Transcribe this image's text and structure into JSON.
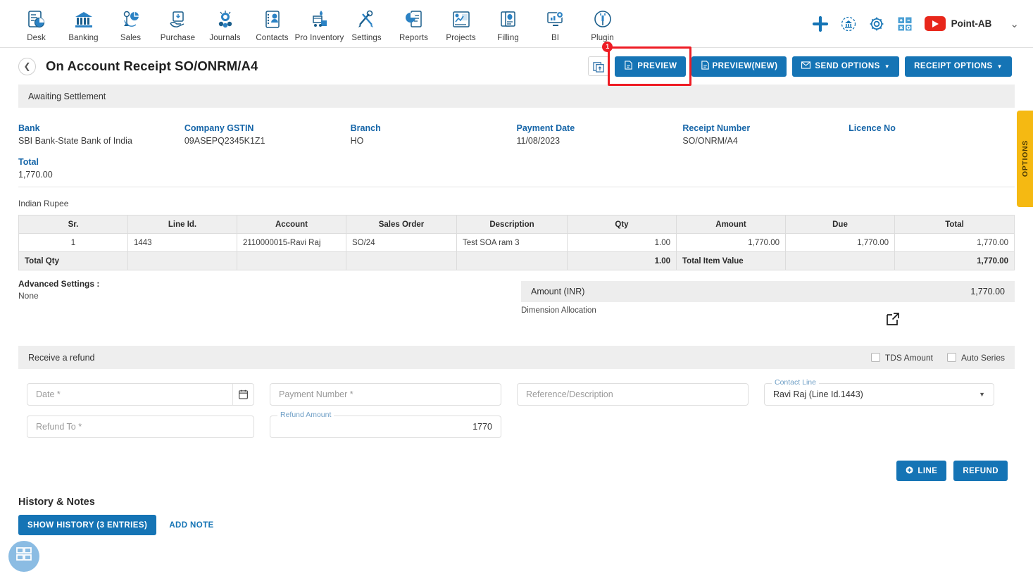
{
  "topnav": {
    "items": [
      {
        "label": "Desk",
        "icon": "desk-icon"
      },
      {
        "label": "Banking",
        "icon": "bank-icon"
      },
      {
        "label": "Sales",
        "icon": "sales-icon"
      },
      {
        "label": "Purchase",
        "icon": "purchase-icon"
      },
      {
        "label": "Journals",
        "icon": "journals-icon"
      },
      {
        "label": "Contacts",
        "icon": "contacts-icon"
      },
      {
        "label": "Pro Inventory",
        "icon": "inventory-icon"
      },
      {
        "label": "Settings",
        "icon": "settings-tools-icon"
      },
      {
        "label": "Reports",
        "icon": "reports-icon"
      },
      {
        "label": "Projects",
        "icon": "projects-icon"
      },
      {
        "label": "Filling",
        "icon": "filling-icon"
      },
      {
        "label": "BI",
        "icon": "bi-icon"
      },
      {
        "label": "Plugin",
        "icon": "plugin-icon"
      }
    ],
    "right": {
      "add_icon": "plus-icon",
      "refresh_bank_icon": "bank-sync-icon",
      "settings_icon": "gear-icon",
      "calculator_icon": "calculator-icon",
      "video_icon": "youtube-icon",
      "brand": "Point-AB",
      "caret_icon": "chevron-down-icon"
    },
    "accent": "#1574b5"
  },
  "header": {
    "back_icon": "chevron-left-icon",
    "title": "On Account Receipt SO/ONRM/A4",
    "upload_icon": "upload-doc-icon",
    "buttons": [
      {
        "label": "PREVIEW",
        "icon": "pdf-icon",
        "highlighted": true,
        "badge": "1"
      },
      {
        "label": "PREVIEW(NEW)",
        "icon": "pdf-icon",
        "highlighted": false
      },
      {
        "label": "SEND OPTIONS",
        "icon": "envelope-icon",
        "caret": true
      },
      {
        "label": "RECEIPT OPTIONS",
        "icon": "",
        "caret": true
      }
    ],
    "highlight_color": "#ee1c24"
  },
  "status_band": {
    "text": "Awaiting Settlement"
  },
  "info_fields": [
    {
      "label": "Bank",
      "value": "SBI Bank-State Bank of India"
    },
    {
      "label": "Company GSTIN",
      "value": "09ASEPQ2345K1Z1"
    },
    {
      "label": "Branch",
      "value": "HO"
    },
    {
      "label": "Payment Date",
      "value": "11/08/2023"
    },
    {
      "label": "Receipt Number",
      "value": "SO/ONRM/A4"
    },
    {
      "label": "Licence No",
      "value": ""
    },
    {
      "label": "Total",
      "value": "1,770.00"
    }
  ],
  "table": {
    "currency_label": "Indian Rupee",
    "columns": [
      "Sr.",
      "Line Id.",
      "Account",
      "Sales Order",
      "Description",
      "Qty",
      "Amount",
      "Due",
      "Total"
    ],
    "rows": [
      {
        "sr": "1",
        "line_id": "1443",
        "account": "2110000015-Ravi Raj",
        "sales_order": "SO/24",
        "description": "Test SOA ram 3",
        "qty": "1.00",
        "amount": "1,770.00",
        "due": "1,770.00",
        "total": "1,770.00"
      }
    ],
    "totals": {
      "label": "Total Qty",
      "qty": "1.00",
      "value_label": "Total Item Value",
      "total": "1,770.00"
    }
  },
  "advanced": {
    "title": "Advanced Settings :",
    "value": "None"
  },
  "amount_panel": {
    "label": "Amount (INR)",
    "value": "1,770.00",
    "dimension_label": "Dimension Allocation",
    "expand_icon": "external-link-icon"
  },
  "refund": {
    "band_title": "Receive a refund",
    "checkboxes": [
      {
        "label": "TDS Amount",
        "checked": false
      },
      {
        "label": "Auto Series",
        "checked": false
      }
    ],
    "fields": {
      "date_placeholder": "Date *",
      "date_value": "",
      "calendar_icon": "calendar-icon",
      "payment_number_placeholder": "Payment Number *",
      "payment_number_value": "",
      "reference_placeholder": "Reference/Description",
      "reference_value": "",
      "contact_line_label": "Contact Line",
      "contact_line_value": "Ravi Raj (Line Id.1443)",
      "contact_caret_icon": "caret-down-icon",
      "refund_to_placeholder": "Refund To *",
      "refund_to_value": "",
      "refund_amount_label": "Refund Amount",
      "refund_amount_value": "1770"
    },
    "buttons": [
      {
        "label": "LINE",
        "icon": "plus-circle-icon"
      },
      {
        "label": "REFUND",
        "icon": ""
      }
    ]
  },
  "history": {
    "title": "History & Notes",
    "show_history_label": "SHOW HISTORY (3 ENTRIES)",
    "add_note_label": "ADD NOTE"
  },
  "options_tab": {
    "label": "OPTIONS",
    "color": "#f5b912"
  },
  "fab": {
    "icon": "widget-grid-icon"
  }
}
